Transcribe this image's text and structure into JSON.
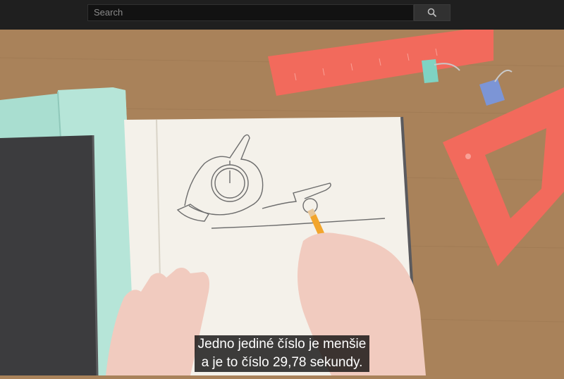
{
  "header": {
    "search": {
      "placeholder": "Search",
      "icon": "search-icon"
    }
  },
  "video": {
    "captions": [
      "Jedno jediné číslo je menšie",
      "a je to číslo 29,78 sekundy."
    ]
  },
  "colors": {
    "topbar": "#1f1f1f",
    "search_field": "#121212",
    "search_button": "#313131",
    "desk": "#a9825a",
    "ruler": "#f26a5c",
    "folder": "#a9ded0",
    "notebook_dark": "#3c3c3e",
    "paper": "#f4f1ea",
    "pencil": "#f2a52c"
  }
}
